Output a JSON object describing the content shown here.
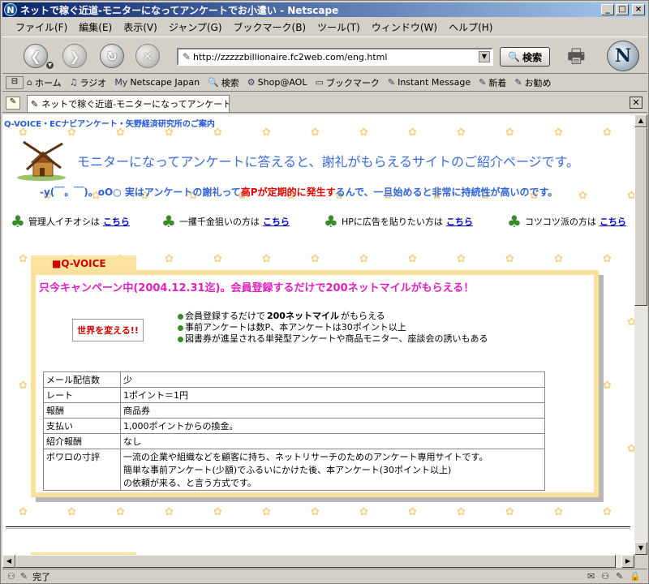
{
  "window": {
    "title": "ネットで稼ぐ近道-モニターになってアンケートでお小遣い - Netscape",
    "min": "_",
    "max": "□",
    "close": "×"
  },
  "menu": [
    "ファイル(F)",
    "編集(E)",
    "表示(V)",
    "ジャンプ(G)",
    "ブックマーク(B)",
    "ツール(T)",
    "ウィンドウ(W)",
    "ヘルプ(H)"
  ],
  "nav": {
    "url": "http://zzzzzbillionaire.fc2web.com/eng.html",
    "search_label": "検索"
  },
  "personal_toolbar": [
    {
      "icon": "home-icon",
      "glyph": "⌂",
      "label": "ホーム"
    },
    {
      "icon": "radio-icon",
      "glyph": "♫",
      "label": "ラジオ"
    },
    {
      "icon": "my-icon",
      "glyph": "My",
      "label": "Netscape Japan"
    },
    {
      "icon": "search-icon",
      "glyph": "🔍",
      "label": "検索"
    },
    {
      "icon": "aol-icon",
      "glyph": "⚙",
      "label": "Shop@AOL"
    },
    {
      "icon": "folder-icon",
      "glyph": "▭",
      "label": "ブックマーク"
    },
    {
      "icon": "link-icon",
      "glyph": "✎",
      "label": "Instant Message"
    },
    {
      "icon": "link-icon",
      "glyph": "✎",
      "label": "新着"
    },
    {
      "icon": "link-icon",
      "glyph": "✎",
      "label": "お勧め"
    }
  ],
  "tab": {
    "label": "ネットで稼ぐ近道-モニターになってアンケートで..."
  },
  "page": {
    "breadcrumb": "Q-VOICE・ECナビアンケート・矢野経済研究所のご案内",
    "headline": "モニターになってアンケートに答えると、謝礼がもらえるサイトのご紹介ページです。",
    "sub_a": "-y(￣。￣)。oO○ 実はアンケートの謝礼って",
    "sub_red": "高Pが定期的に発生す",
    "sub_b": "るんで、一旦始めると非常に持続性が高いのです。",
    "links": [
      {
        "text": "管理人イチオシは",
        "link": "こちら"
      },
      {
        "text": "一攫千金狙いの方は",
        "link": "こちら"
      },
      {
        "text": "HPに広告を貼りたい方は",
        "link": "こちら"
      },
      {
        "text": "コツコツ派の方は",
        "link": "こちら"
      }
    ],
    "section_tab": "■Q-VOICE",
    "campaign": "只今キャンペーン中(2004.12.31迄)。会員登録するだけで200ネットマイルがもらえる！",
    "banner": "世界を変える!!",
    "bullets": [
      {
        "pre": "会員登録するだけで",
        "bold": "200ネットマイル",
        "post": "がもらえる"
      },
      {
        "pre": "事前アンケートは数P、本アンケートは30ポイント以上",
        "bold": "",
        "post": ""
      },
      {
        "pre": "図書券が進呈される単発型アンケートや商品モニター、座談会の誘いもある",
        "bold": "",
        "post": ""
      }
    ],
    "table": [
      {
        "k": "メール配信数",
        "v": "少"
      },
      {
        "k": "レート",
        "v": "1ポイント＝1円"
      },
      {
        "k": "報酬",
        "v": "商品券"
      },
      {
        "k": "支払い",
        "v": "1,000ポイントからの換金。"
      },
      {
        "k": "紹介報酬",
        "v": "なし"
      },
      {
        "k": "ボワロの寸評",
        "v": "一流の企業や組織などを顧客に持ち、ネットリサーチのためのアンケート専用サイトです。",
        "v2": "簡単な事前アンケート(少額)でふるいにかけた後、本アンケート(30ポイント以上)",
        "v3": "の依頼が来る、と言う方式です。"
      }
    ]
  },
  "status": {
    "text": "完了"
  },
  "colors": {
    "title_gradient_start": "#0a246a",
    "accent_blue": "#3a6bd8",
    "campaign_pink": "#e020c0",
    "box_border": "#fddfa0"
  }
}
